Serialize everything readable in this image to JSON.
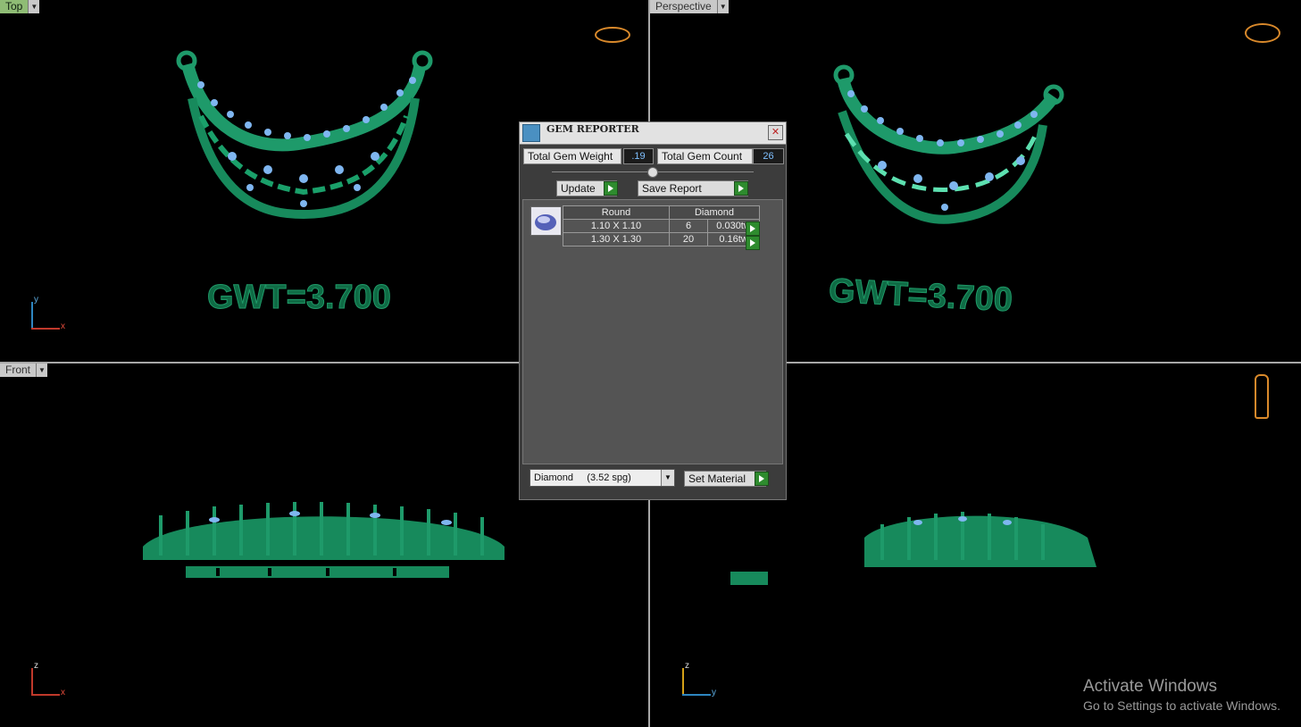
{
  "viewports": {
    "top": {
      "label": "Top",
      "gwt": "GWT=3.700",
      "axis_v": "y",
      "axis_h": "x"
    },
    "perspective": {
      "label": "Perspective",
      "gwt": "GWT=3.700"
    },
    "front": {
      "label": "Front",
      "axis_v": "z",
      "axis_h": "x"
    },
    "right": {
      "axis_v": "z",
      "axis_h": "y"
    }
  },
  "gem_reporter": {
    "title": "GEM REPORTER",
    "total_weight_label": "Total Gem Weight",
    "total_weight_value": ".19",
    "total_count_label": "Total Gem Count",
    "total_count_value": "26",
    "update_label": "Update",
    "save_report_label": "Save Report",
    "table": {
      "shape_header": "Round",
      "material_header": "Diamond",
      "rows": [
        {
          "size": "1.10 X 1.10",
          "count": "6",
          "weight": "0.030tw"
        },
        {
          "size": "1.30 X 1.30",
          "count": "20",
          "weight": "0.16tw"
        }
      ]
    },
    "material_select": "Diamond     (3.52 spg)",
    "set_material_label": "Set Material"
  },
  "watermark": {
    "title": "Activate Windows",
    "subtitle": "Go to Settings to activate Windows."
  },
  "colors": {
    "metal": "#1e9a6a",
    "gem": "#7fb6f0",
    "label_green": "#8fbc75"
  }
}
